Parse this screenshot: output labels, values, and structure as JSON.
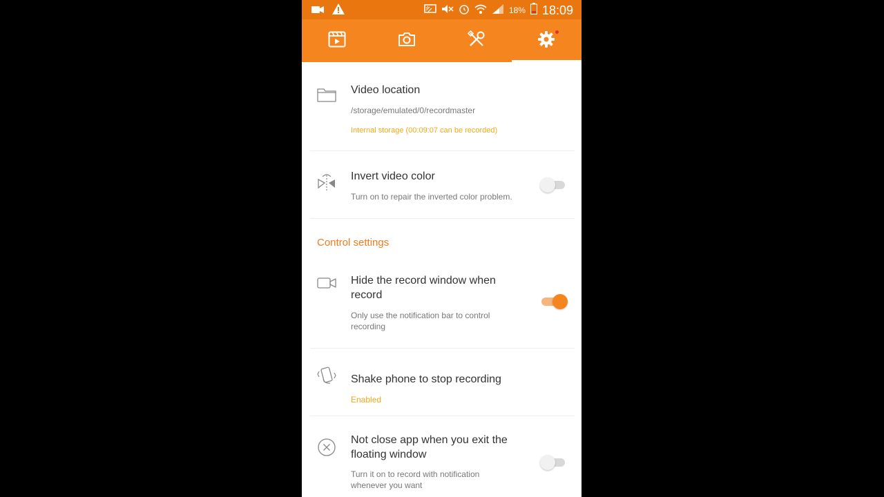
{
  "status_bar": {
    "battery_percent": "18%",
    "time": "18:09",
    "icons": [
      "video-camera-icon",
      "warning-icon",
      "cast-icon",
      "mute-icon",
      "alarm-icon",
      "wifi-icon",
      "signal-icon",
      "battery-icon"
    ]
  },
  "tabs": [
    {
      "name": "video-list",
      "icon": "film-icon"
    },
    {
      "name": "screenshot",
      "icon": "camera-icon"
    },
    {
      "name": "tools",
      "icon": "tools-icon"
    },
    {
      "name": "settings",
      "icon": "gear-icon",
      "active": true
    }
  ],
  "settings": {
    "video_location": {
      "title": "Video location",
      "path": "/storage/emulated/0/recordmaster",
      "storage": "Internal storage (00:09:07 can be recorded)"
    },
    "invert_color": {
      "title": "Invert video color",
      "sub": "Turn on to repair the inverted color problem.",
      "enabled": false
    },
    "section_title": "Control settings",
    "hide_window": {
      "title_line1": "Hide the record window when",
      "title_line2": "record",
      "sub_line1": "Only use the notification bar to control",
      "sub_line2": "recording",
      "enabled": true
    },
    "shake": {
      "title": "Shake phone to stop recording",
      "status": "Enabled"
    },
    "not_close": {
      "title_line1": "Not close app when you exit the",
      "title_line2": "floating window",
      "sub_line1": "Turn it on to record with notification",
      "sub_line2": "whenever you want",
      "enabled": false
    }
  },
  "colors": {
    "accent": "#f5861f",
    "status_bar": "#ea7610",
    "section_title": "#ef7b1d",
    "highlight_text": "#f0a818"
  }
}
